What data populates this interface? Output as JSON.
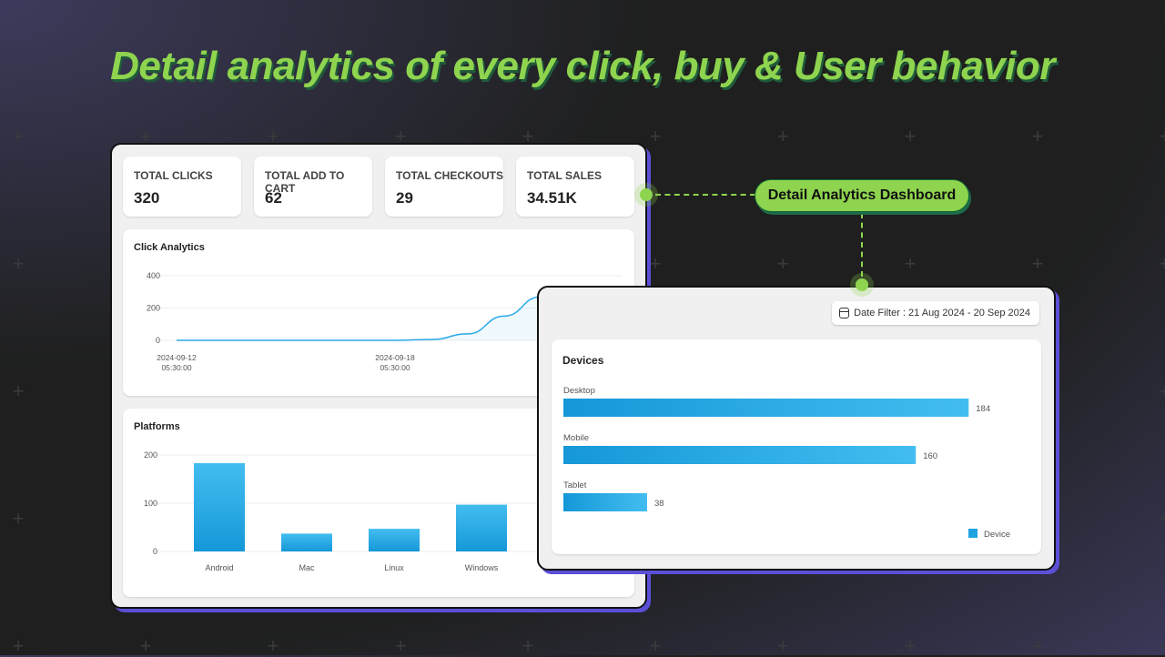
{
  "headline": "Detail analytics of every click, buy & User behavior",
  "callout": "Detail Analytics Dashboard",
  "stats": [
    {
      "label": "TOTAL CLICKS",
      "value": "320"
    },
    {
      "label": "TOTAL ADD TO CART",
      "value": "62"
    },
    {
      "label": "TOTAL CHECKOUTS",
      "value": "29"
    },
    {
      "label": "TOTAL SALES",
      "value": "34.51K"
    }
  ],
  "date_filter": {
    "icon": "calendar-icon",
    "label": "Date Filter : 21 Aug 2024 - 20 Sep 2024"
  },
  "colors": {
    "accent": "#8fd44f",
    "bar": "#1fa3e0",
    "line": "#2aa8e8",
    "shadow": "#5b4fd6"
  },
  "chart_data": [
    {
      "type": "line",
      "title": "Click Analytics",
      "y_ticks": [
        "0",
        "200",
        "400"
      ],
      "ylim": [
        0,
        400
      ],
      "x_tick_labels": [
        {
          "date": "2024-09-12",
          "time": "05:30:00"
        },
        {
          "date": "2024-09-18",
          "time": "05:30:00"
        }
      ],
      "x": [
        "2024-09-12",
        "2024-09-13",
        "2024-09-14",
        "2024-09-15",
        "2024-09-16",
        "2024-09-17",
        "2024-09-18",
        "2024-09-19",
        "2024-09-20",
        "2024-09-21",
        "2024-09-22"
      ],
      "values": [
        0,
        0,
        0,
        0,
        0,
        0,
        0,
        5,
        40,
        150,
        270
      ],
      "grid": true
    },
    {
      "type": "bar",
      "title": "Platforms",
      "categories": [
        "Android",
        "Mac",
        "Linux",
        "Windows"
      ],
      "values": [
        183,
        37,
        47,
        97
      ],
      "y_ticks": [
        "0",
        "100",
        "200"
      ],
      "ylim": [
        0,
        200
      ],
      "grid": true
    },
    {
      "type": "bar",
      "orientation": "horizontal",
      "title": "Devices",
      "categories": [
        "Desktop",
        "Mobile",
        "Tablet"
      ],
      "values": [
        184,
        160,
        38
      ],
      "legend": {
        "label": "Device",
        "position": "bottom-right"
      }
    }
  ]
}
